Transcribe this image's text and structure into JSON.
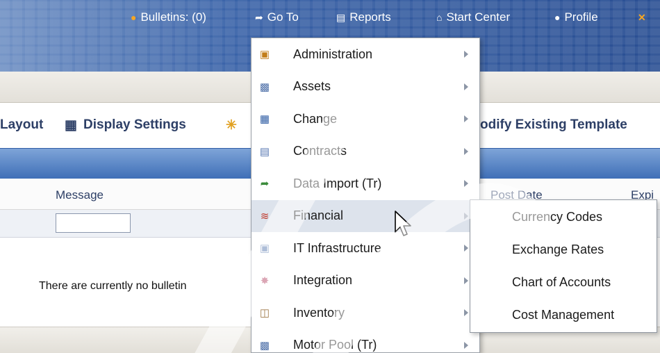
{
  "header": {
    "bulletins_label": "Bulletins: (0)",
    "goto_label": "Go To",
    "reports_label": "Reports",
    "start_center_label": "Start Center",
    "profile_label": "Profile"
  },
  "toolbar": {
    "layout_label": "Layout",
    "display_settings_label": "Display Settings",
    "modify_template_label": "odify Existing Template"
  },
  "table": {
    "col_message": "Message",
    "col_post_date": "Post Date",
    "col_expiry": "Expi",
    "empty_message": "There are currently no bulletin",
    "filter_value": ""
  },
  "menu": {
    "items": [
      {
        "label": "Administration",
        "icon": "administration-icon"
      },
      {
        "label": "Assets",
        "icon": "assets-icon"
      },
      {
        "label": "Change",
        "icon": "change-icon"
      },
      {
        "label": "Contracts",
        "icon": "contracts-icon"
      },
      {
        "label": "Data Import (Tr)",
        "icon": "data-import-icon"
      },
      {
        "label": "Financial",
        "icon": "financial-icon"
      },
      {
        "label": "IT Infrastructure",
        "icon": "it-infrastructure-icon"
      },
      {
        "label": "Integration",
        "icon": "integration-icon"
      },
      {
        "label": "Inventory",
        "icon": "inventory-icon"
      },
      {
        "label": "Motor Pool (Tr)",
        "icon": "motor-pool-icon"
      }
    ],
    "selected": "Financial"
  },
  "submenu": {
    "items": [
      {
        "label": "Currency Codes"
      },
      {
        "label": "Exchange Rates"
      },
      {
        "label": "Chart of Accounts"
      },
      {
        "label": "Cost Management"
      }
    ]
  },
  "colors": {
    "header_blue": "#2a4f93",
    "strip_blue": "#3f6fb7",
    "menu_selected": "#dde3ec",
    "toolbar_text": "#2d3f66"
  }
}
